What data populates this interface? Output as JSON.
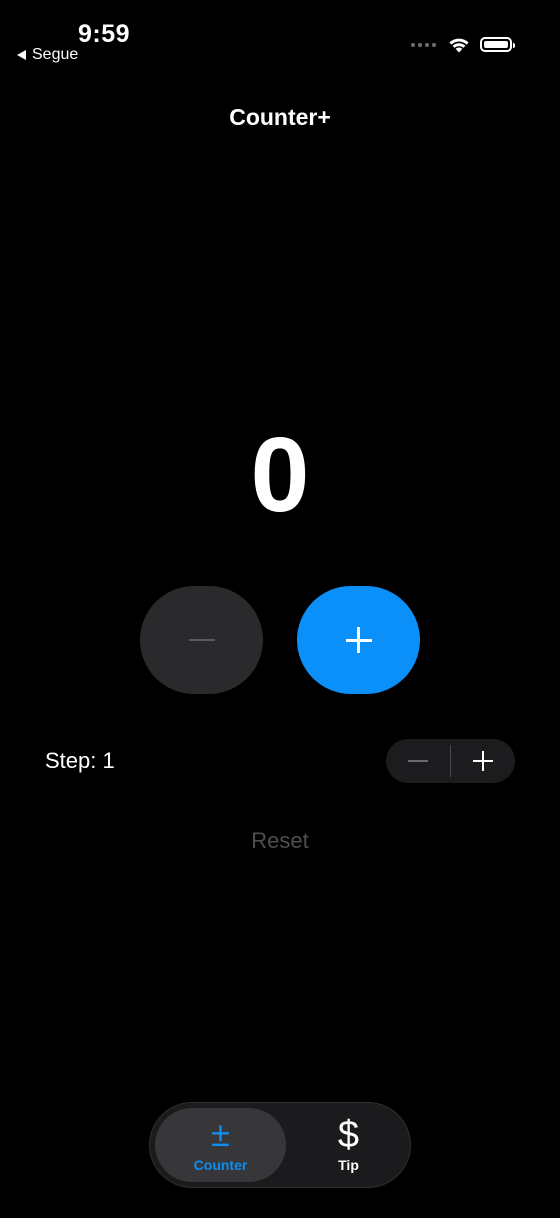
{
  "status_bar": {
    "time": "9:59",
    "back_label": "Segue"
  },
  "nav": {
    "title": "Counter+"
  },
  "counter": {
    "value": "0"
  },
  "step": {
    "label": "Step: 1"
  },
  "reset": {
    "label": "Reset"
  },
  "tabs": [
    {
      "label": "Counter",
      "icon": "±",
      "selected": true
    },
    {
      "label": "Tip",
      "icon": "$",
      "selected": false
    }
  ],
  "colors": {
    "accent": "#0B8FF9",
    "background": "#000000",
    "button_gray": "#2A2A2C",
    "disabled_text": "#4E4E50"
  }
}
